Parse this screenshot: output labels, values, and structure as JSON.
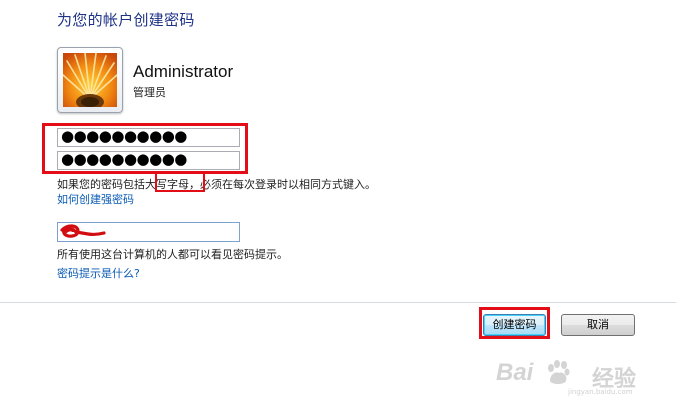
{
  "dialog": {
    "title": "为您的帐户创建密码"
  },
  "account": {
    "username": "Administrator",
    "role": "管理员"
  },
  "password": {
    "new_value": "●●●●●●●●●●",
    "confirm_value": "●●●●●●●●●●"
  },
  "notes": {
    "case_sensitivity": "如果您的密码包括大写字母，必须在每次登录时以相同方式键入。",
    "strong_password_link": "如何创建强密码",
    "hint_visibility": "所有使用这台计算机的人都可以看见密码提示。",
    "hint_help_link": "密码提示是什么?"
  },
  "buttons": {
    "create_label": "创建密码",
    "cancel_label": "取消"
  },
  "watermark": {
    "brand_latin": "Bai",
    "brand_cn": "经验",
    "url": "jingyan.baidu.com"
  },
  "colors": {
    "title": "#1e3287",
    "link": "#0a5bb4",
    "highlight": "#e30d17"
  }
}
